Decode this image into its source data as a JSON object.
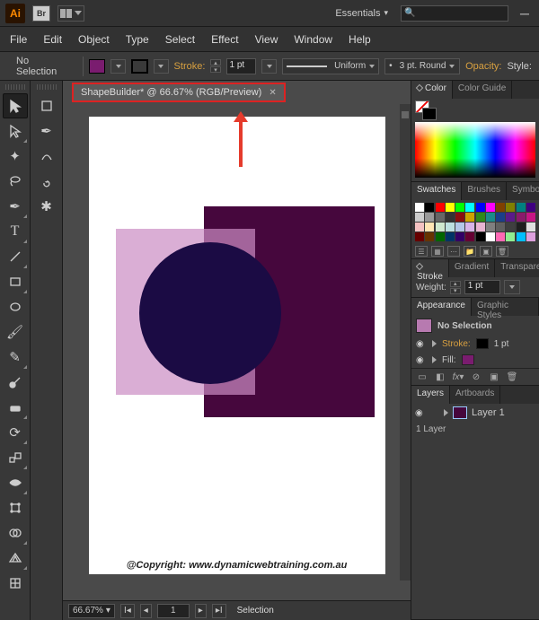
{
  "appbar": {
    "logo": "Ai",
    "bridge": "Br",
    "workspace": "Essentials",
    "search_placeholder": ""
  },
  "menu": [
    "File",
    "Edit",
    "Object",
    "Type",
    "Select",
    "Effect",
    "View",
    "Window",
    "Help"
  ],
  "control": {
    "selection": "No Selection",
    "stroke_label": "Stroke:",
    "stroke_weight": "1 pt",
    "brush_profile": "Uniform",
    "brush_def": "3 pt. Round",
    "opacity_label": "Opacity:",
    "style_label": "Style:"
  },
  "doc": {
    "tab_title": "ShapeBuilder* @ 66.67% (RGB/Preview)"
  },
  "status": {
    "zoom": "66.67%",
    "page": "1",
    "tool": "Selection"
  },
  "copyright": "@Copyright: www.dynamicwebtraining.com.au",
  "panels": {
    "color_tab": "Color",
    "color_guide_tab": "Color Guide",
    "swatches_tab": "Swatches",
    "brushes_tab": "Brushes",
    "symbols_tab": "Symbols",
    "stroke_tab": "Stroke",
    "gradient_tab": "Gradient",
    "transparency_tab": "Transparency",
    "stroke_weight_label": "Weight:",
    "stroke_weight_value": "1 pt",
    "appearance_tab": "Appearance",
    "graphic_styles_tab": "Graphic Styles",
    "appearance_title": "No Selection",
    "appearance_stroke": "Stroke:",
    "appearance_stroke_val": "1 pt",
    "appearance_fill": "Fill:",
    "layers_tab": "Layers",
    "artboards_tab": "Artboards",
    "layer1": "Layer 1",
    "layer_count": "1 Layer"
  },
  "tools_left": [
    "selection",
    "direct-selection",
    "magic-wand",
    "lasso",
    "pen",
    "type",
    "line-segment",
    "rectangle",
    "ellipse",
    "paintbrush",
    "pencil",
    "blob-brush",
    "eraser",
    "rotate",
    "scale",
    "width",
    "free-transform",
    "shape-builder",
    "perspective-grid",
    "mesh",
    "gradient",
    "eyedropper",
    "blend",
    "symbol-sprayer",
    "column-graph"
  ],
  "tools_sec": [
    "selection-alt",
    "direct-alt",
    "group-sel",
    "curvature",
    "spiral"
  ],
  "swatch_rows": [
    [
      "#ffffff",
      "#000000",
      "#ff0000",
      "#ffff00",
      "#00ff00",
      "#00ffff",
      "#0000ff",
      "#ff00ff",
      "#804000",
      "#808000",
      "#008080",
      "#400080"
    ],
    [
      "#cccccc",
      "#999999",
      "#666666",
      "#333333",
      "#8a0f0f",
      "#cca300",
      "#2e8a1a",
      "#1a8a8a",
      "#1a3e8a",
      "#5a1a8a",
      "#8a1a6b",
      "#c71585"
    ],
    [
      "#f4c2c2",
      "#ffe5b4",
      "#cfe8cf",
      "#bde0e0",
      "#b4c7e7",
      "#d8b4e7",
      "#e7b4d1",
      "#7f7f7f",
      "#5f5f5f",
      "#3f3f3f",
      "#1f1f1f",
      "#e0e0e0"
    ],
    [
      "#660000",
      "#663300",
      "#006600",
      "#003366",
      "#330066",
      "#660033",
      "#000000",
      "#ffffff",
      "#ff69b4",
      "#90ee90",
      "#00bfff",
      "#dda0dd"
    ]
  ]
}
